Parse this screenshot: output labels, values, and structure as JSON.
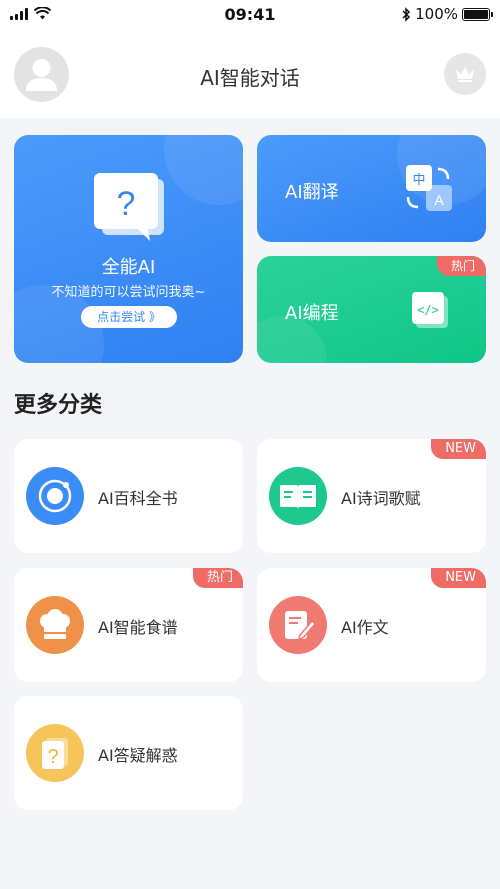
{
  "status_bar": {
    "time": "09:41",
    "battery": "100%"
  },
  "header": {
    "title": "AI智能对话",
    "avatar_icon": "user-avatar-icon",
    "vip_icon": "crown-icon"
  },
  "featured": {
    "main": {
      "title": "全能AI",
      "subtitle": "不知道的可以尝试问我奥~",
      "button": "点击尝试 》",
      "icon": "question-bubble-icon"
    },
    "translate": {
      "title": "AI翻译",
      "icon": "translate-icon"
    },
    "coding": {
      "title": "AI编程",
      "badge": "热门",
      "icon": "code-icon"
    }
  },
  "section": {
    "title": "更多分类"
  },
  "categories": [
    {
      "label": "AI百科全书",
      "icon": "orbit-icon",
      "color": "#3a8cf7",
      "badge": ""
    },
    {
      "label": "AI诗词歌赋",
      "icon": "book-icon",
      "color": "#1fc88c",
      "badge": "NEW"
    },
    {
      "label": "AI智能食谱",
      "icon": "chef-hat-icon",
      "color": "#f0914a",
      "badge": "热门"
    },
    {
      "label": "AI作文",
      "icon": "note-edit-icon",
      "color": "#ef7a72",
      "badge": "NEW"
    },
    {
      "label": "AI答疑解惑",
      "icon": "question-note-icon",
      "color": "#f5c45a",
      "badge": ""
    }
  ],
  "colors": {
    "blue": "#3a86f5",
    "green": "#14c98a",
    "badge_red": "#ef6b66",
    "background": "#f4f5f9"
  }
}
